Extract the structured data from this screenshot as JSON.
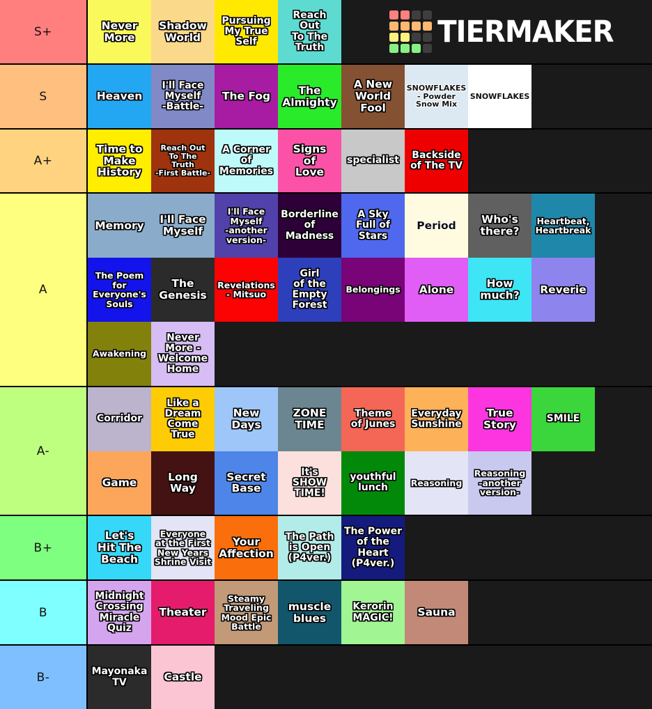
{
  "brand": {
    "name": "TIERMAKER",
    "logo_swatches": [
      "#ff8080",
      "#ff8080",
      "#3e3e3e",
      "#3e3e3e",
      "#ffb871",
      "#ffb871",
      "#ffb871",
      "#ffb871",
      "#fff07f",
      "#fff07f",
      "#3e3e3e",
      "#3e3e3e",
      "#86f086",
      "#86f086",
      "#86f086",
      "#3e3e3e"
    ]
  },
  "tiers": [
    {
      "label": "S+",
      "label_color": "#ff7f7f",
      "rows": [
        [
          {
            "text": "Never\nMore",
            "bg": "#f9f95b",
            "size": "fs-16"
          },
          {
            "text": "Shadow\nWorld",
            "bg": "#fbd98a",
            "size": "fs-16"
          },
          {
            "text": "Pursuing\nMy True\nSelf",
            "bg": "#ffe900",
            "size": "fs-14"
          },
          {
            "text": "Reach\nOut\nTo The\nTruth",
            "bg": "#5ddbd0",
            "size": "fs-14"
          }
        ]
      ]
    },
    {
      "label": "S",
      "label_color": "#ffbf7f",
      "rows": [
        [
          {
            "text": "Heaven",
            "bg": "#24a7f2",
            "size": "fs-16"
          },
          {
            "text": "I'll Face\nMyself\n-Battle-",
            "bg": "#8189c6",
            "size": "fs-14"
          },
          {
            "text": "The Fog",
            "bg": "#a81ba3",
            "size": "fs-16"
          },
          {
            "text": "The\nAlmighty",
            "bg": "#2aeb2a",
            "size": "fs-16"
          },
          {
            "text": "A New\nWorld\nFool",
            "bg": "#845132",
            "size": "fs-16"
          },
          {
            "text": "SNOWFLAKES\n- Powder\nSnow Mix",
            "bg": "#dde9f2",
            "size": "fs-11",
            "dark": true
          },
          {
            "text": "SNOWFLAKES",
            "bg": "#ffffff",
            "size": "fs-11",
            "dark": true
          }
        ]
      ]
    },
    {
      "label": "A+",
      "label_color": "#ffd37f",
      "rows": [
        [
          {
            "text": "Time to\nMake\nHistory",
            "bg": "#ffee00",
            "size": "fs-16"
          },
          {
            "text": "Reach Out\nTo The\nTruth\n-First Battle-",
            "bg": "#9e330d",
            "size": "fs-11"
          },
          {
            "text": "A Corner\nof\nMemories",
            "bg": "#befaf9",
            "size": "fs-14"
          },
          {
            "text": "Signs\nof\nLove",
            "bg": "#fb52a8",
            "size": "fs-16"
          },
          {
            "text": "specialist",
            "bg": "#c8c8c8",
            "size": "fs-14"
          },
          {
            "text": "Backside\nof The TV",
            "bg": "#ee0000",
            "size": "fs-14"
          }
        ]
      ]
    },
    {
      "label": "A",
      "label_color": "#ffff7f",
      "rows": [
        [
          {
            "text": "Memory",
            "bg": "#8aacca",
            "size": "fs-16"
          },
          {
            "text": "I'll Face\nMyself",
            "bg": "#8aacca",
            "size": "fs-16"
          },
          {
            "text": "I'll Face\nMyself\n-another\nversion-",
            "bg": "#5141ab",
            "size": "fs-12"
          },
          {
            "text": "Borderline\nof\nMadness",
            "bg": "#2e0038",
            "size": "fs-14"
          },
          {
            "text": "A Sky\nFull of\nStars",
            "bg": "#4f68ee",
            "size": "fs-14"
          },
          {
            "text": "Period",
            "bg": "#fffbe0",
            "size": "fs-16",
            "dark": true
          },
          {
            "text": "Who's\nthere?",
            "bg": "#606060",
            "size": "fs-16"
          },
          {
            "text": "Heartbeat,\nHeartbreak",
            "bg": "#1f87aa",
            "size": "fs-12"
          }
        ],
        [
          {
            "text": "The Poem\nfor\nEveryone's\nSouls",
            "bg": "#1313ec",
            "size": "fs-12"
          },
          {
            "text": "The\nGenesis",
            "bg": "#2b2b2b",
            "size": "fs-16"
          },
          {
            "text": "Revelations\n- Mitsuo",
            "bg": "#fb0303",
            "size": "fs-12"
          },
          {
            "text": "Girl\nof the\nEmpty\nForest",
            "bg": "#2e3fbb",
            "size": "fs-14"
          },
          {
            "text": "Belongings",
            "bg": "#780478",
            "size": "fs-12"
          },
          {
            "text": "Alone",
            "bg": "#e05df6",
            "size": "fs-16"
          },
          {
            "text": "How\nmuch?",
            "bg": "#3de5f5",
            "size": "fs-16"
          },
          {
            "text": "Reverie",
            "bg": "#8e84ed",
            "size": "fs-16"
          }
        ],
        [
          {
            "text": "Awakening",
            "bg": "#81810c",
            "size": "fs-12"
          },
          {
            "text": "Never\nMore -\nWelcome\nHome",
            "bg": "#d6bdf4",
            "size": "fs-14"
          }
        ]
      ]
    },
    {
      "label": "A-",
      "label_color": "#bfff7f",
      "rows": [
        [
          {
            "text": "Corridor",
            "bg": "#bcb3cd",
            "size": "fs-14"
          },
          {
            "text": "Like a\nDream\nCome\nTrue",
            "bg": "#fdcc04",
            "size": "fs-14"
          },
          {
            "text": "New\nDays",
            "bg": "#9fc6f9",
            "size": "fs-16"
          },
          {
            "text": "ZONE\nTIME",
            "bg": "#6c8691",
            "size": "fs-16"
          },
          {
            "text": "Theme\nof Junes",
            "bg": "#f46655",
            "size": "fs-14"
          },
          {
            "text": "Everyday\nSunshine",
            "bg": "#fdb159",
            "size": "fs-14"
          },
          {
            "text": "True\nStory",
            "bg": "#fc35e1",
            "size": "fs-16"
          },
          {
            "text": "SMILE",
            "bg": "#3bd63b",
            "size": "fs-14"
          }
        ],
        [
          {
            "text": "Game",
            "bg": "#fca65b",
            "size": "fs-16"
          },
          {
            "text": "Long\nWay",
            "bg": "#441212",
            "size": "fs-16"
          },
          {
            "text": "Secret\nBase",
            "bg": "#4d85e8",
            "size": "fs-16"
          },
          {
            "text": "It's\nSHOW\nTIME!",
            "bg": "#fce0de",
            "size": "fs-14"
          },
          {
            "text": "youthful\nlunch",
            "bg": "#03890a",
            "size": "fs-14"
          },
          {
            "text": "Reasoning",
            "bg": "#e3e4f6",
            "size": "fs-12"
          },
          {
            "text": "Reasoning\n-another\nversion-",
            "bg": "#c9c9f0",
            "size": "fs-12"
          }
        ]
      ]
    },
    {
      "label": "B+",
      "label_color": "#7fff7f",
      "rows": [
        [
          {
            "text": "Let's\nHit The\nBeach",
            "bg": "#35d8f8",
            "size": "fs-16"
          },
          {
            "text": "Everyone\nat the First\nNew Years\nShrine Visit",
            "bg": "#e3e4f6",
            "size": "fs-12"
          },
          {
            "text": "Your\nAffection",
            "bg": "#fb6e0c",
            "size": "fs-16"
          },
          {
            "text": "The Path\nis Open\n(P4ver.)",
            "bg": "#b2ece8",
            "size": "fs-14"
          },
          {
            "text": "The Power\nof the\nHeart\n(P4ver.)",
            "bg": "#141b7c",
            "size": "fs-14"
          }
        ]
      ]
    },
    {
      "label": "B",
      "label_color": "#7fffff",
      "rows": [
        [
          {
            "text": "Midnight\nCrossing\nMiracle\nQuiz",
            "bg": "#d5a4ef",
            "size": "fs-14"
          },
          {
            "text": "Theater",
            "bg": "#e51c6b",
            "size": "fs-16"
          },
          {
            "text": "Steamy\nTraveling\nMood Epic\nBattle",
            "bg": "#c29a78",
            "size": "fs-12"
          },
          {
            "text": "muscle\nblues",
            "bg": "#12566b",
            "size": "fs-16"
          },
          {
            "text": "Kerorin\nMAGIC!",
            "bg": "#a1f592",
            "size": "fs-14"
          },
          {
            "text": "Sauna",
            "bg": "#c28878",
            "size": "fs-16"
          }
        ]
      ]
    },
    {
      "label": "B-",
      "label_color": "#7fbfff",
      "rows": [
        [
          {
            "text": "Mayonaka\nTV",
            "bg": "#2b2b2b",
            "size": "fs-14"
          },
          {
            "text": "Castle",
            "bg": "#fbc5d4",
            "size": "fs-16"
          }
        ]
      ]
    }
  ]
}
